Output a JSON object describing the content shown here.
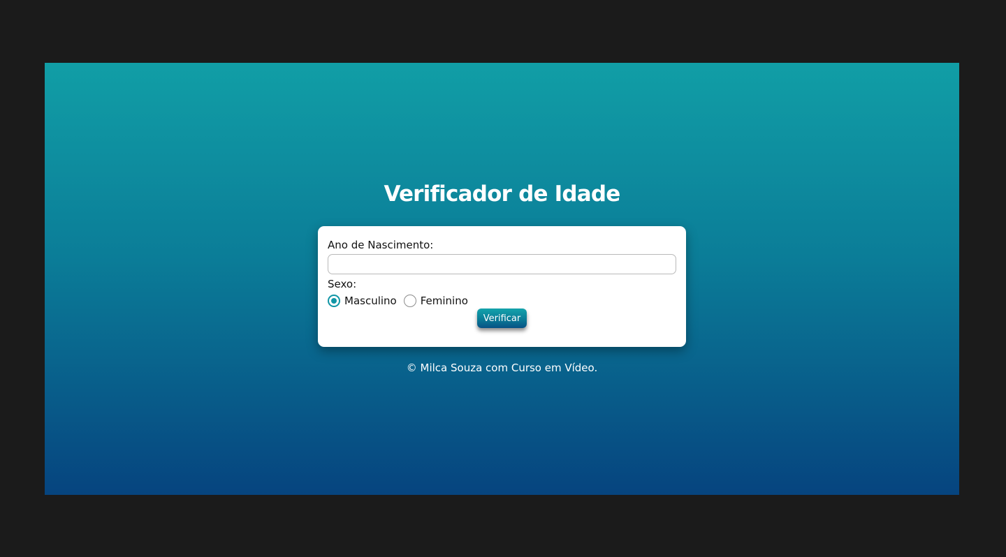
{
  "header": {
    "title": "Verificador de Idade"
  },
  "form": {
    "birth_year_label": "Ano de Nascimento:",
    "birth_year_value": "",
    "sex_label": "Sexo:",
    "options": [
      {
        "label": "Masculino",
        "checked": true
      },
      {
        "label": "Feminino",
        "checked": false
      }
    ],
    "submit_label": "Verificar"
  },
  "footer": {
    "text": "© Milca Souza com Curso em Vídeo."
  },
  "colors": {
    "page_background": "#1b1b1b",
    "gradient_top": "#119ea6",
    "gradient_bottom": "#06447f",
    "accent": "#1196a6"
  }
}
